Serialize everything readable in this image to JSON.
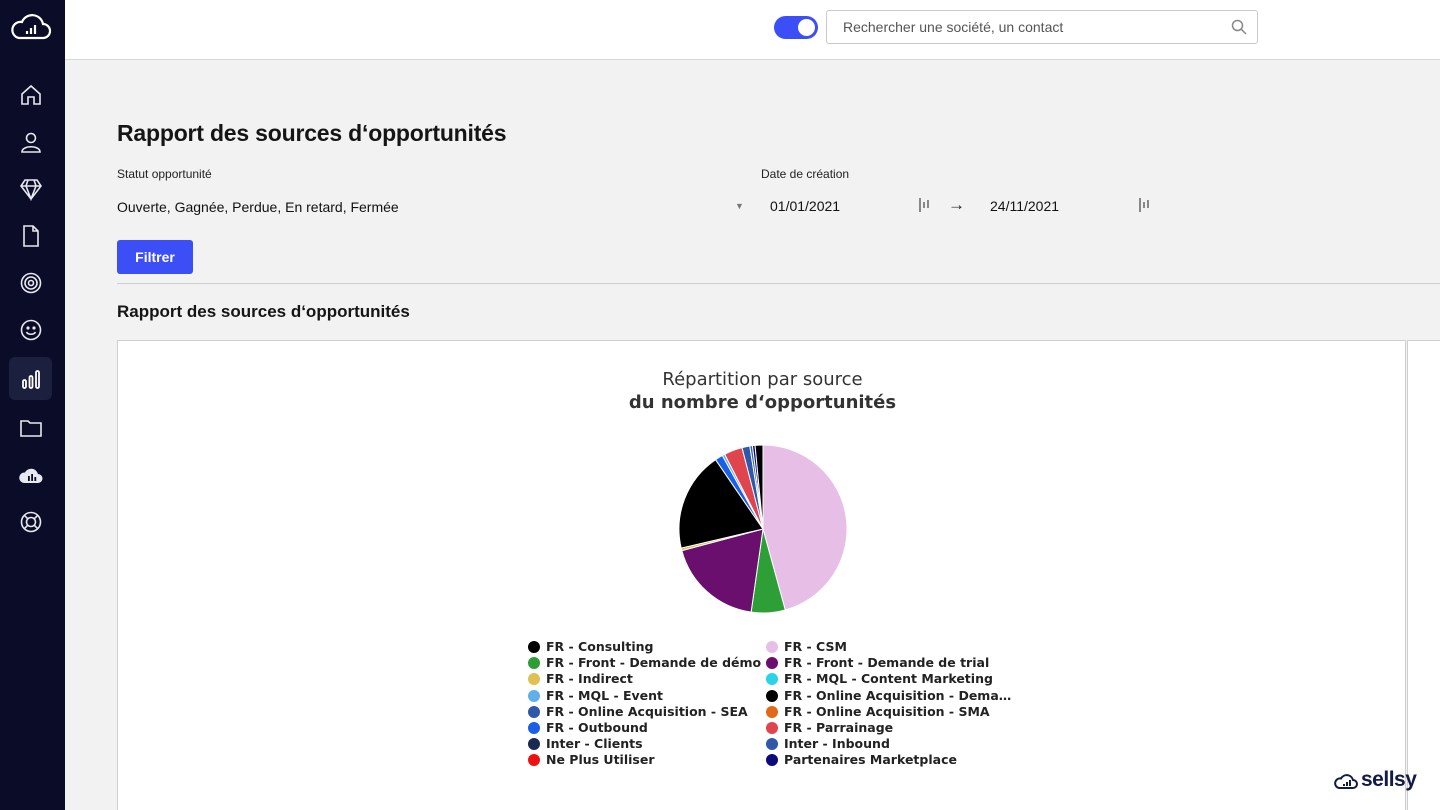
{
  "header": {
    "search": {
      "placeholder": "Rechercher une société, un contact",
      "value": ""
    },
    "toggle": {
      "on": true
    }
  },
  "sidebar": {
    "items": [
      {
        "icon": "home-icon"
      },
      {
        "icon": "user-icon"
      },
      {
        "icon": "diamond-icon"
      },
      {
        "icon": "document-icon"
      },
      {
        "icon": "target-icon"
      },
      {
        "icon": "smiley-icon"
      },
      {
        "icon": "bar-chart-icon",
        "active": true
      },
      {
        "icon": "folder-icon"
      },
      {
        "icon": "cloud-chart-icon"
      },
      {
        "icon": "lifebuoy-icon"
      }
    ]
  },
  "page": {
    "title": "Rapport des sources d‘opportunités",
    "filters": {
      "status_label": "Statut opportunité",
      "status_value": "Ouverte, Gagnée, Perdue, En retard, Fermée",
      "date_label": "Date de création",
      "date_from": "01/01/2021",
      "date_to": "24/11/2021",
      "filter_button": "Filtrer"
    },
    "section_title": "Rapport des sources d‘opportunités"
  },
  "chart_data": {
    "type": "pie",
    "title": "Répartition par source",
    "subtitle": "du nombre d‘opportunités",
    "slices": [
      {
        "name": "FR - CSM",
        "value": 45.5,
        "color": "#e6bee6"
      },
      {
        "name": "FR - Front - Demande de démo",
        "value": 6.5,
        "color": "#2e9e36"
      },
      {
        "name": "FR - Front - Demande de trial",
        "value": 18.5,
        "color": "#6a0f6e"
      },
      {
        "name": "FR - Indirect",
        "value": 0.5,
        "color": "#e0c050"
      },
      {
        "name": "FR - Consulting",
        "value": 19.0,
        "color": "#000000"
      },
      {
        "name": "FR - Outbound",
        "value": 1.5,
        "color": "#1a5fe8"
      },
      {
        "name": "FR - MQL - Event",
        "value": 0.5,
        "color": "#5fb0e8"
      },
      {
        "name": "FR - Parrainage",
        "value": 3.5,
        "color": "#e0444c"
      },
      {
        "name": "Inter - Inbound",
        "value": 1.5,
        "color": "#2f58a8"
      },
      {
        "name": "FR - Online Acquisition - SEA",
        "value": 0.5,
        "color": "#3060b0"
      },
      {
        "name": "Partenaires Marketplace",
        "value": 0.5,
        "color": "#0a0a7a"
      },
      {
        "name": "FR - Online Acquisition - Demande...",
        "value": 1.5,
        "color": "#000000"
      }
    ],
    "legend": [
      {
        "name": "FR - Consulting",
        "color": "#000000"
      },
      {
        "name": "FR - CSM",
        "color": "#e6bee6"
      },
      {
        "name": "FR - Front - Demande de démo",
        "color": "#2e9e36"
      },
      {
        "name": "FR - Front - Demande de trial",
        "color": "#6a0f6e"
      },
      {
        "name": "FR - Indirect",
        "color": "#e0c050"
      },
      {
        "name": "FR - MQL - Content Marketing",
        "color": "#2ad4e6"
      },
      {
        "name": "FR - MQL - Event",
        "color": "#5fb0e8"
      },
      {
        "name": "FR - Online Acquisition - Dema…",
        "color": "#000000"
      },
      {
        "name": "FR - Online Acquisition - SEA",
        "color": "#2f58a8"
      },
      {
        "name": "FR - Online Acquisition - SMA",
        "color": "#e06a1a"
      },
      {
        "name": "FR - Outbound",
        "color": "#1a5fe8"
      },
      {
        "name": "FR - Parrainage",
        "color": "#e0444c"
      },
      {
        "name": "Inter - Clients",
        "color": "#1a2a50"
      },
      {
        "name": "Inter - Inbound",
        "color": "#2f58a8"
      },
      {
        "name": "Ne Plus Utiliser",
        "color": "#ee1111"
      },
      {
        "name": "Partenaires Marketplace",
        "color": "#0a0a7a"
      }
    ]
  },
  "brand": {
    "name": "sellsy"
  },
  "colors": {
    "accent": "#3c4ef5",
    "sidebar": "#0b0d28"
  }
}
